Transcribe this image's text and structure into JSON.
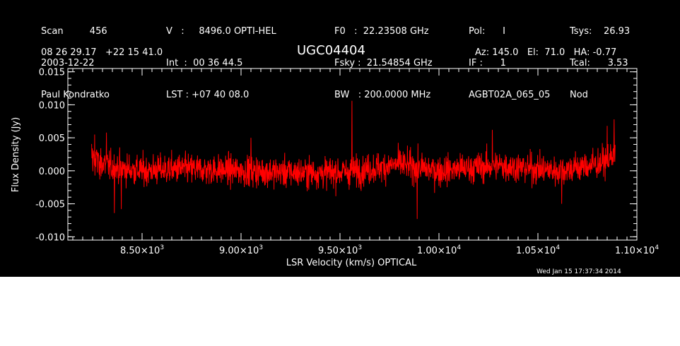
{
  "header": {
    "col1": [
      "Scan         456",
      "2003-12-22",
      "Paul Kondratko"
    ],
    "col2": [
      "V   :     8496.0 OPTI-HEL",
      "Int  :  00 36 44.5",
      "LST : +07 40 08.0"
    ],
    "col3": [
      "F0   :  22.23508 GHz",
      "Fsky :  21.54854 GHz",
      "BW   : 200.0000 MHz"
    ],
    "col4": [
      "Pol:      I",
      "IF :      1",
      "AGBT02A_065_05"
    ],
    "col5": [
      "Tsys:    26.93",
      "Tcal:      3.53",
      "Nod"
    ],
    "coords": "08 26 29.17   +22 15 41.0",
    "source": "UGC04404",
    "azelha": "Az: 145.0   El:  71.0   HA: -0.77",
    "timestamp": "Wed Jan 15 17:37:34 2014"
  },
  "colors": {
    "background": "#000000",
    "axes": "#ffffff",
    "series": "#ff0000"
  },
  "chart_data": {
    "type": "line",
    "xlabel": "LSR Velocity (km/s) OPTICAL",
    "ylabel": "Flux Density (Jy)",
    "xlim": [
      8125,
      11000
    ],
    "ylim": [
      -0.0105,
      0.0155
    ],
    "x_ticks": [
      {
        "value": 8500,
        "mantissa": "8.50",
        "exp": "3"
      },
      {
        "value": 9000,
        "mantissa": "9.00",
        "exp": "3"
      },
      {
        "value": 9500,
        "mantissa": "9.50",
        "exp": "3"
      },
      {
        "value": 10000,
        "mantissa": "1.00",
        "exp": "4"
      },
      {
        "value": 10500,
        "mantissa": "1.05",
        "exp": "4"
      },
      {
        "value": 11000,
        "mantissa": "1.10",
        "exp": "4"
      }
    ],
    "y_ticks": [
      {
        "value": 0.015,
        "label": "0.015"
      },
      {
        "value": 0.01,
        "label": "0.010"
      },
      {
        "value": 0.005,
        "label": "0.005"
      },
      {
        "value": 0.0,
        "label": "0.000"
      },
      {
        "value": -0.005,
        "label": "-0.005"
      },
      {
        "value": -0.01,
        "label": "-0.010"
      }
    ],
    "series": [
      {
        "x_start": 8245,
        "x_end": 10890,
        "rms": 0.0018,
        "trend": [
          [
            8245,
            0.002
          ],
          [
            8350,
            0.0005
          ],
          [
            8500,
            0.0
          ],
          [
            8700,
            0.0003
          ],
          [
            9000,
            0.0
          ],
          [
            9300,
            -0.0003
          ],
          [
            9550,
            -0.0002
          ],
          [
            9800,
            0.001
          ],
          [
            10000,
            0.0
          ],
          [
            10300,
            0.0008
          ],
          [
            10600,
            0.0
          ],
          [
            10800,
            0.001
          ],
          [
            10890,
            0.002
          ]
        ],
        "peaks": [
          [
            8260,
            0.0055
          ],
          [
            8320,
            0.0058
          ],
          [
            8360,
            -0.0064
          ],
          [
            8395,
            -0.0058
          ],
          [
            9050,
            0.005
          ],
          [
            9560,
            0.0106
          ],
          [
            9890,
            -0.0073
          ],
          [
            10270,
            0.0062
          ],
          [
            10620,
            -0.005
          ],
          [
            10850,
            0.0068
          ],
          [
            10885,
            0.0078
          ]
        ]
      }
    ]
  }
}
